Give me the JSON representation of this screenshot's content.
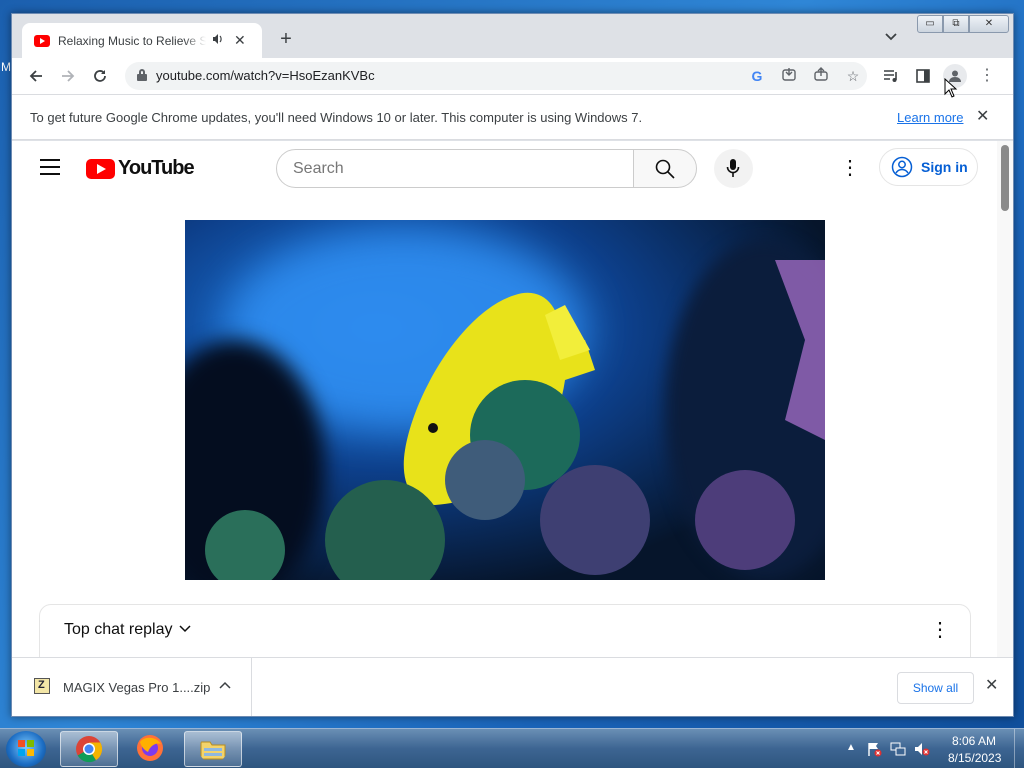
{
  "desktop": {
    "edge_glyph": "M"
  },
  "browser": {
    "tab": {
      "title": "Relaxing Music to Relieve Stress",
      "audio_icon": "speaker-icon",
      "close_glyph": "✕"
    },
    "new_tab_glyph": "+",
    "tab_search_glyph": "⌄",
    "window_controls": {
      "minimize": "▭",
      "maximize": "⧉",
      "close": "✕"
    },
    "url": "youtube.com/watch?v=HsoEzanKVBc",
    "infobar": {
      "message": "To get future Google Chrome updates, you'll need Windows 10 or later. This computer is using Windows 7.",
      "learn_more": "Learn more"
    }
  },
  "youtube": {
    "logo_text": "YouTube",
    "search": {
      "placeholder": "Search"
    },
    "sign_in": "Sign in",
    "chat": {
      "title": "Top chat replay"
    }
  },
  "download_shelf": {
    "file_name": "MAGIX Vegas Pro 1....zip",
    "show_all": "Show all"
  },
  "taskbar": {
    "clock_time": "8:06 AM",
    "clock_date": "8/15/2023"
  },
  "colors": {
    "youtube_red": "#ff0000",
    "link_blue": "#1a73e8",
    "signin_blue": "#065fd4",
    "tab_strip": "#dee1e6"
  }
}
